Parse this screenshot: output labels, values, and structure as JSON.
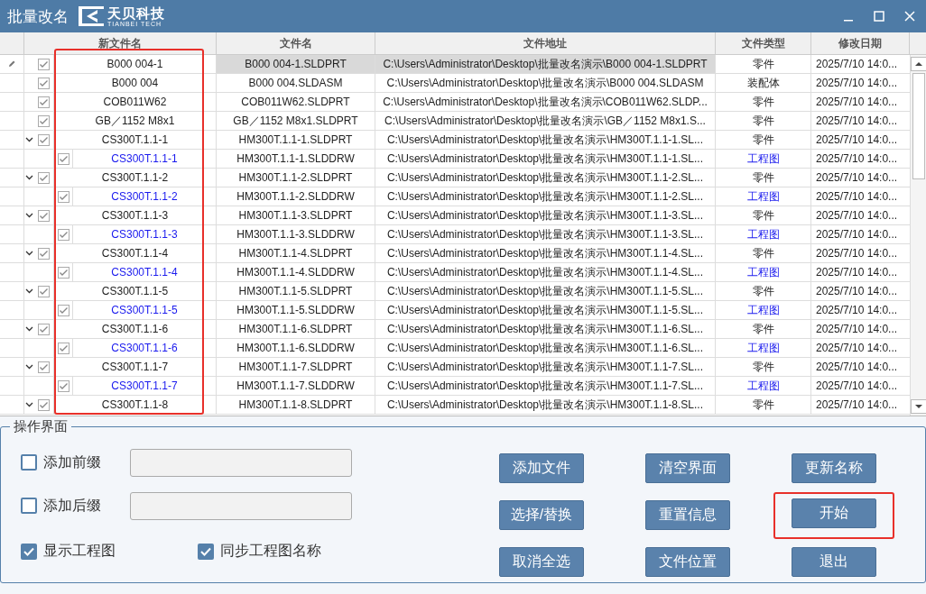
{
  "window": {
    "title": "批量改名",
    "logo_name": "天贝科技",
    "logo_sub": "TIANBEI TECH"
  },
  "table": {
    "columns": [
      "新文件名",
      "文件名",
      "文件地址",
      "文件类型",
      "修改日期"
    ],
    "rows": [
      {
        "kind": "part",
        "checked": true,
        "selected": true,
        "new_name": "B000 004-1",
        "file_name": "B000 004-1.SLDPRT",
        "path": "C:\\Users\\Administrator\\Desktop\\批量改名演示\\B000 004-1.SLDPRT",
        "type": "零件",
        "date": "2025/7/10 14:0..."
      },
      {
        "kind": "part",
        "checked": true,
        "selected": false,
        "new_name": "B000 004",
        "file_name": "B000 004.SLDASM",
        "path": "C:\\Users\\Administrator\\Desktop\\批量改名演示\\B000 004.SLDASM",
        "type": "装配体",
        "date": "2025/7/10 14:0..."
      },
      {
        "kind": "part",
        "checked": true,
        "selected": false,
        "new_name": "COB011W62",
        "file_name": "COB011W62.SLDPRT",
        "path": "C:\\Users\\Administrator\\Desktop\\批量改名演示\\COB011W62.SLDP...",
        "type": "零件",
        "date": "2025/7/10 14:0..."
      },
      {
        "kind": "part",
        "checked": true,
        "selected": false,
        "new_name": "GB／1152 M8x1",
        "file_name": "GB／1152 M8x1.SLDPRT",
        "path": "C:\\Users\\Administrator\\Desktop\\批量改名演示\\GB／1152 M8x1.S...",
        "type": "零件",
        "date": "2025/7/10 14:0..."
      },
      {
        "kind": "part",
        "checked": true,
        "selected": false,
        "expanded": true,
        "new_name": "CS300T.1.1-1",
        "file_name": "HM300T.1.1-1.SLDPRT",
        "path": "C:\\Users\\Administrator\\Desktop\\批量改名演示\\HM300T.1.1-1.SL...",
        "type": "零件",
        "date": "2025/7/10 14:0...",
        "children": [
          {
            "kind": "drawing",
            "checked": true,
            "selected": false,
            "new_name": "CS300T.1.1-1",
            "file_name": "HM300T.1.1-1.SLDDRW",
            "path": "C:\\Users\\Administrator\\Desktop\\批量改名演示\\HM300T.1.1-1.SL...",
            "type": "工程图",
            "date": "2025/7/10 14:0..."
          }
        ]
      },
      {
        "kind": "part",
        "checked": true,
        "selected": false,
        "expanded": true,
        "new_name": "CS300T.1.1-2",
        "file_name": "HM300T.1.1-2.SLDPRT",
        "path": "C:\\Users\\Administrator\\Desktop\\批量改名演示\\HM300T.1.1-2.SL...",
        "type": "零件",
        "date": "2025/7/10 14:0...",
        "children": [
          {
            "kind": "drawing",
            "checked": true,
            "selected": false,
            "new_name": "CS300T.1.1-2",
            "file_name": "HM300T.1.1-2.SLDDRW",
            "path": "C:\\Users\\Administrator\\Desktop\\批量改名演示\\HM300T.1.1-2.SL...",
            "type": "工程图",
            "date": "2025/7/10 14:0..."
          }
        ]
      },
      {
        "kind": "part",
        "checked": true,
        "selected": false,
        "expanded": true,
        "new_name": "CS300T.1.1-3",
        "file_name": "HM300T.1.1-3.SLDPRT",
        "path": "C:\\Users\\Administrator\\Desktop\\批量改名演示\\HM300T.1.1-3.SL...",
        "type": "零件",
        "date": "2025/7/10 14:0...",
        "children": [
          {
            "kind": "drawing",
            "checked": true,
            "selected": false,
            "new_name": "CS300T.1.1-3",
            "file_name": "HM300T.1.1-3.SLDDRW",
            "path": "C:\\Users\\Administrator\\Desktop\\批量改名演示\\HM300T.1.1-3.SL...",
            "type": "工程图",
            "date": "2025/7/10 14:0..."
          }
        ]
      },
      {
        "kind": "part",
        "checked": true,
        "selected": false,
        "expanded": true,
        "new_name": "CS300T.1.1-4",
        "file_name": "HM300T.1.1-4.SLDPRT",
        "path": "C:\\Users\\Administrator\\Desktop\\批量改名演示\\HM300T.1.1-4.SL...",
        "type": "零件",
        "date": "2025/7/10 14:0...",
        "children": [
          {
            "kind": "drawing",
            "checked": true,
            "selected": false,
            "new_name": "CS300T.1.1-4",
            "file_name": "HM300T.1.1-4.SLDDRW",
            "path": "C:\\Users\\Administrator\\Desktop\\批量改名演示\\HM300T.1.1-4.SL...",
            "type": "工程图",
            "date": "2025/7/10 14:0..."
          }
        ]
      },
      {
        "kind": "part",
        "checked": true,
        "selected": false,
        "expanded": true,
        "new_name": "CS300T.1.1-5",
        "file_name": "HM300T.1.1-5.SLDPRT",
        "path": "C:\\Users\\Administrator\\Desktop\\批量改名演示\\HM300T.1.1-5.SL...",
        "type": "零件",
        "date": "2025/7/10 14:0...",
        "children": [
          {
            "kind": "drawing",
            "checked": true,
            "selected": false,
            "new_name": "CS300T.1.1-5",
            "file_name": "HM300T.1.1-5.SLDDRW",
            "path": "C:\\Users\\Administrator\\Desktop\\批量改名演示\\HM300T.1.1-5.SL...",
            "type": "工程图",
            "date": "2025/7/10 14:0..."
          }
        ]
      },
      {
        "kind": "part",
        "checked": true,
        "selected": false,
        "expanded": true,
        "new_name": "CS300T.1.1-6",
        "file_name": "HM300T.1.1-6.SLDPRT",
        "path": "C:\\Users\\Administrator\\Desktop\\批量改名演示\\HM300T.1.1-6.SL...",
        "type": "零件",
        "date": "2025/7/10 14:0...",
        "children": [
          {
            "kind": "drawing",
            "checked": true,
            "selected": false,
            "new_name": "CS300T.1.1-6",
            "file_name": "HM300T.1.1-6.SLDDRW",
            "path": "C:\\Users\\Administrator\\Desktop\\批量改名演示\\HM300T.1.1-6.SL...",
            "type": "工程图",
            "date": "2025/7/10 14:0..."
          }
        ]
      },
      {
        "kind": "part",
        "checked": true,
        "selected": false,
        "expanded": true,
        "new_name": "CS300T.1.1-7",
        "file_name": "HM300T.1.1-7.SLDPRT",
        "path": "C:\\Users\\Administrator\\Desktop\\批量改名演示\\HM300T.1.1-7.SL...",
        "type": "零件",
        "date": "2025/7/10 14:0...",
        "children": [
          {
            "kind": "drawing",
            "checked": true,
            "selected": false,
            "new_name": "CS300T.1.1-7",
            "file_name": "HM300T.1.1-7.SLDDRW",
            "path": "C:\\Users\\Administrator\\Desktop\\批量改名演示\\HM300T.1.1-7.SL...",
            "type": "工程图",
            "date": "2025/7/10 14:0..."
          }
        ]
      },
      {
        "kind": "part",
        "checked": true,
        "selected": false,
        "expanded": true,
        "new_name": "CS300T.1.1-8",
        "file_name": "HM300T.1.1-8.SLDPRT",
        "path": "C:\\Users\\Administrator\\Desktop\\批量改名演示\\HM300T.1.1-8.SL...",
        "type": "零件",
        "date": "2025/7/10 14:0..."
      }
    ]
  },
  "panel": {
    "title": "操作界面",
    "options": [
      {
        "label": "添加前缀",
        "checked": false
      },
      {
        "label": "添加后缀",
        "checked": false
      }
    ],
    "toggles": [
      {
        "label": "显示工程图",
        "checked": true
      },
      {
        "label": "同步工程图名称",
        "checked": true
      }
    ],
    "buttons": [
      {
        "label": "添加文件",
        "highlighted": false
      },
      {
        "label": "清空界面",
        "highlighted": false
      },
      {
        "label": "更新名称",
        "highlighted": false
      },
      {
        "label": "选择/替换",
        "highlighted": false
      },
      {
        "label": "重置信息",
        "highlighted": false
      },
      {
        "label": "开始",
        "highlighted": true
      },
      {
        "label": "取消全选",
        "highlighted": false
      },
      {
        "label": "文件位置",
        "highlighted": false
      },
      {
        "label": "退出",
        "highlighted": false
      }
    ]
  }
}
